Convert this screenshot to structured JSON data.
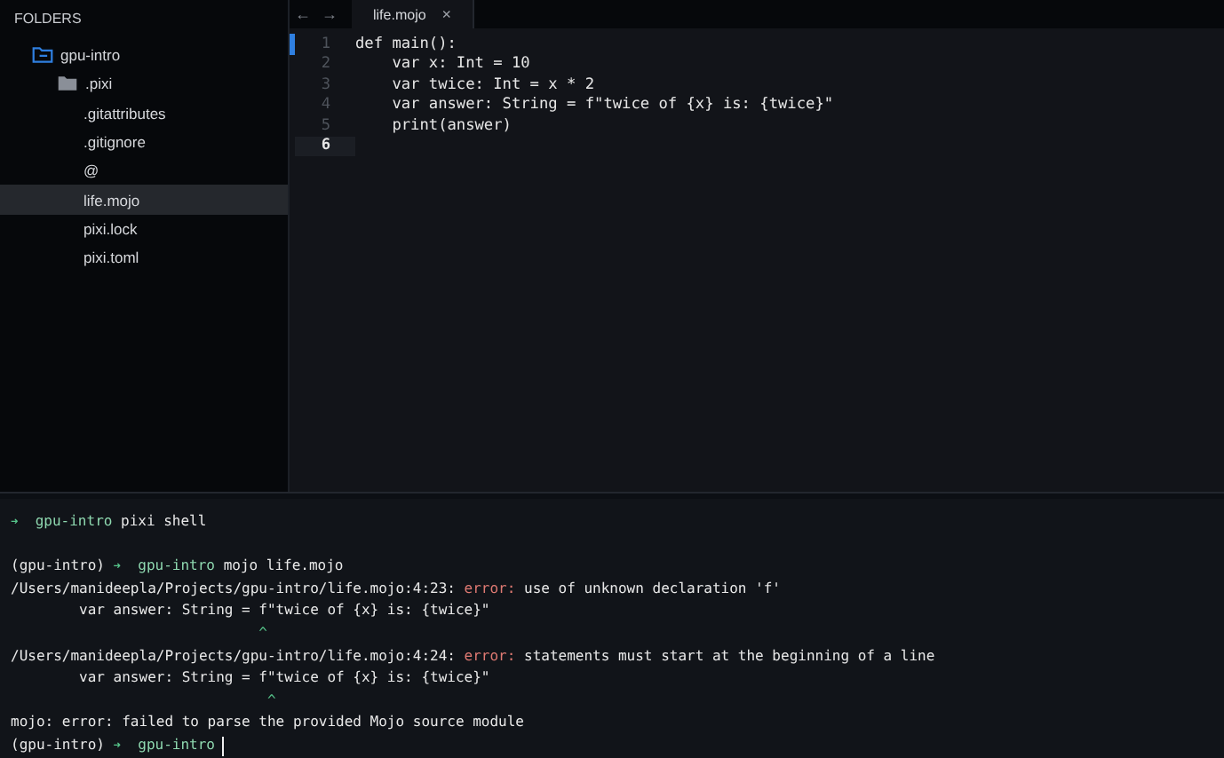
{
  "sidebar": {
    "heading": "FOLDERS",
    "tree": [
      {
        "label": "gpu-intro",
        "kind": "folder",
        "expanded": true,
        "selected": false,
        "children": [
          {
            "label": ".pixi",
            "kind": "folder",
            "expanded": false,
            "selected": false
          },
          {
            "label": ".gitattributes",
            "kind": "file",
            "selected": false
          },
          {
            "label": ".gitignore",
            "kind": "file",
            "selected": false
          },
          {
            "label": "@",
            "kind": "file",
            "selected": false
          },
          {
            "label": "life.mojo",
            "kind": "file",
            "selected": true
          },
          {
            "label": "pixi.lock",
            "kind": "file",
            "selected": false
          },
          {
            "label": "pixi.toml",
            "kind": "file",
            "selected": false
          }
        ]
      }
    ]
  },
  "editor": {
    "nav": [
      "←",
      "→"
    ],
    "tabs": [
      {
        "label": "life.mojo",
        "selected": true,
        "close": "×"
      }
    ],
    "lines": [
      {
        "number": "1",
        "text": "def main():",
        "selected": false,
        "changed": true
      },
      {
        "number": "2",
        "text": "    var x: Int = 10",
        "selected": false,
        "changed": false
      },
      {
        "number": "3",
        "text": "    var twice: Int = x * 2",
        "selected": false,
        "changed": false
      },
      {
        "number": "4",
        "text": "    var answer: String = f\"twice of {x} is: {twice}\"",
        "selected": false,
        "changed": false
      },
      {
        "number": "5",
        "text": "    print(answer)",
        "selected": false,
        "changed": false
      },
      {
        "number": "6",
        "selected": true,
        "changed": false
      }
    ]
  },
  "terminal": {
    "lines": [
      [
        {
          "kind": "arrow",
          "text": "➜"
        },
        {
          "kind": "dir",
          "text": "  gpu-intro"
        },
        {
          "kind": "text",
          "text": " pixi shell"
        }
      ],
      [
        {
          "kind": "blank"
        }
      ],
      [
        {
          "kind": "text",
          "text": "(gpu-intro) "
        },
        {
          "kind": "arrow",
          "text": "➜"
        },
        {
          "kind": "dir",
          "text": "  gpu-intro"
        },
        {
          "kind": "text",
          "text": " mojo life.mojo"
        }
      ],
      [
        {
          "kind": "text",
          "text": "/Users/manideepla/Projects/gpu-intro/life.mojo:4:23: "
        },
        {
          "kind": "error",
          "text": "error:"
        },
        {
          "kind": "text",
          "text": " use of unknown declaration 'f'"
        }
      ],
      [
        {
          "kind": "text",
          "text": "        var answer: String = f\"twice of {x} is: {twice}\""
        }
      ],
      [
        {
          "kind": "caret",
          "text": "                             ^"
        }
      ],
      [
        {
          "kind": "text",
          "text": "/Users/manideepla/Projects/gpu-intro/life.mojo:4:24: "
        },
        {
          "kind": "error",
          "text": "error:"
        },
        {
          "kind": "text",
          "text": " statements must start at the beginning of a line"
        }
      ],
      [
        {
          "kind": "text",
          "text": "        var answer: String = f\"twice of {x} is: {twice}\""
        }
      ],
      [
        {
          "kind": "caret",
          "text": "                              ^"
        }
      ],
      [
        {
          "kind": "text",
          "text": "mojo: error: failed to parse the provided Mojo source module"
        }
      ],
      [
        {
          "kind": "text",
          "text": "(gpu-intro) "
        },
        {
          "kind": "arrow",
          "text": "➜"
        },
        {
          "kind": "dir",
          "text": "  gpu-intro"
        },
        {
          "kind": "cursor"
        }
      ]
    ]
  }
}
